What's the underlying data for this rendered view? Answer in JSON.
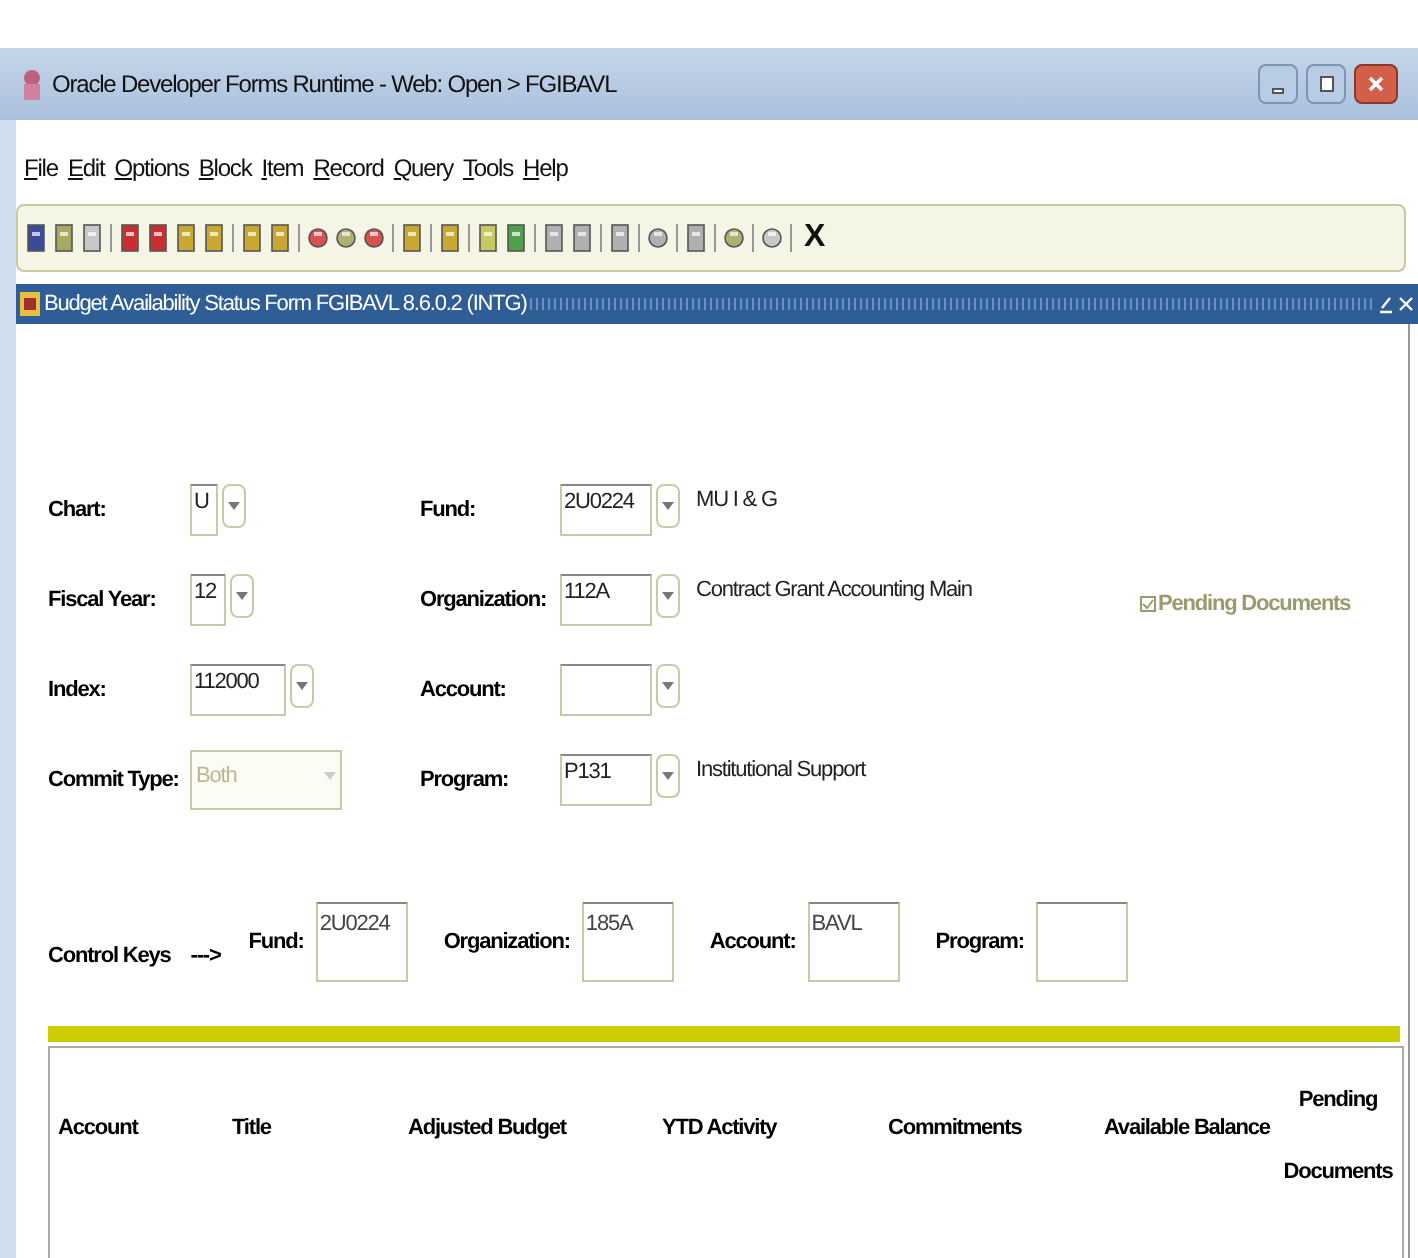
{
  "window": {
    "title": "Oracle Developer Forms Runtime - Web:  Open > FGIBAVL"
  },
  "menu": [
    "File",
    "Edit",
    "Options",
    "Block",
    "Item",
    "Record",
    "Query",
    "Tools",
    "Help"
  ],
  "toolbar": {
    "exit_label": "X"
  },
  "form": {
    "title": "Budget Availability Status Form  FGIBAVL  8.6.0.2  (INTG)",
    "left_fields": [
      {
        "label": "Chart:",
        "value": "U",
        "kind": "lov",
        "disabled": false
      },
      {
        "label": "Fiscal Year:",
        "value": "12",
        "kind": "lov",
        "disabled": false
      },
      {
        "label": "Index:",
        "value": "112000",
        "kind": "lov",
        "disabled": false
      },
      {
        "label": "Commit Type:",
        "value": "Both",
        "kind": "select",
        "disabled": true
      }
    ],
    "right_fields": [
      {
        "label": "Fund:",
        "value": "2U0224",
        "description": "MU I & G"
      },
      {
        "label": "Organization:",
        "value": "112A",
        "description": "Contract Grant Accounting Main"
      },
      {
        "label": "Account:"
      },
      {
        "label": "Program:",
        "value": "P131",
        "description": "Institutional Support"
      }
    ],
    "pending_documents": {
      "label": "Pending Documents",
      "checked": true,
      "disabled": true
    },
    "control_keys": {
      "label": "Control Keys",
      "arrow": "--->",
      "fields": [
        {
          "label": "Fund:",
          "value": "2U0224"
        },
        {
          "label": "Organization:",
          "value": "185A"
        },
        {
          "label": "Account:",
          "value": "BAVL"
        },
        {
          "label": "Program:"
        }
      ]
    },
    "table": {
      "columns": [
        "Account",
        "Title",
        "Adjusted Budget",
        "YTD Activity",
        "Commitments",
        "Available Balance",
        "Pending Documents"
      ]
    }
  }
}
